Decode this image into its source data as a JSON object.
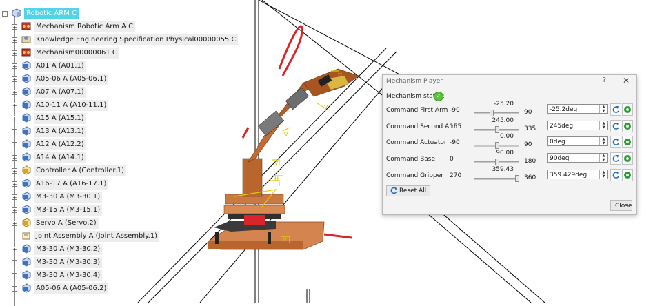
{
  "tree": {
    "root": "Robotic ARM C",
    "items": [
      {
        "label": "Mechanism Robotic Arm A C",
        "icon": "mechanism-icon"
      },
      {
        "label": "Knowledge Engineering Specification Physical00000055 C",
        "icon": "knowledge-spec-icon"
      },
      {
        "label": "Mechanism00000061 C",
        "icon": "mechanism-icon"
      },
      {
        "label": "A01 A (A01.1)",
        "icon": "part-icon"
      },
      {
        "label": "A05-06 A (A05-06.1)",
        "icon": "part-icon"
      },
      {
        "label": "A07 A (A07.1)",
        "icon": "part-icon"
      },
      {
        "label": "A10-11 A (A10-11.1)",
        "icon": "part-icon"
      },
      {
        "label": "A15 A (A15.1)",
        "icon": "part-icon"
      },
      {
        "label": "A13 A (A13.1)",
        "icon": "part-icon"
      },
      {
        "label": "A12 A (A12.2)",
        "icon": "part-icon"
      },
      {
        "label": "A14 A (A14.1)",
        "icon": "part-icon"
      },
      {
        "label": "Controller A (Controller.1)",
        "icon": "product-icon"
      },
      {
        "label": "A16-17 A (A16-17.1)",
        "icon": "part-icon"
      },
      {
        "label": "M3-30 A (M3-30.1)",
        "icon": "part-icon"
      },
      {
        "label": "M3-15 A (M3-15.1)",
        "icon": "part-icon"
      },
      {
        "label": "Servo A (Servo.2)",
        "icon": "product-icon"
      },
      {
        "label": "Joint Assembly A (Joint Assembly.1)",
        "icon": "assembly-icon"
      },
      {
        "label": "M3-30 A (M3-30.2)",
        "icon": "part-icon"
      },
      {
        "label": "M3-30 A (M3-30.3)",
        "icon": "part-icon"
      },
      {
        "label": "M3-30 A (M3-30.4)",
        "icon": "part-icon"
      },
      {
        "label": "A05-06 A (A05-06.2)",
        "icon": "part-icon"
      }
    ]
  },
  "dialog": {
    "title": "Mechanism Player",
    "help": "?",
    "close_x": "✕",
    "status_label": "Mechanism status:",
    "status_icon": "check-icon",
    "commands": [
      {
        "name": "Command First Arm",
        "min": "-90",
        "current": "-25.20",
        "max": "90",
        "value": "-25.2deg",
        "position": 0.36
      },
      {
        "name": "Command Second Arm",
        "min": "155",
        "current": "245.00",
        "max": "335",
        "value": "245deg",
        "position": 0.5
      },
      {
        "name": "Command Actuator",
        "min": "-90",
        "current": "0.00",
        "max": "90",
        "value": "0deg",
        "position": 0.5
      },
      {
        "name": "Command Base",
        "min": "0",
        "current": "90.00",
        "max": "180",
        "value": "90deg",
        "position": 0.5
      },
      {
        "name": "Command Gripper",
        "min": "270",
        "current": "359.43",
        "max": "360",
        "value": "359.429deg",
        "position": 0.99
      }
    ],
    "reset_label": "Reset All",
    "close_label": "Close"
  },
  "colors": {
    "root_highlight": "#4fd4e8",
    "status_ok": "#5cc43a",
    "wood": "#c8753a",
    "compass_red": "#d9242a"
  }
}
